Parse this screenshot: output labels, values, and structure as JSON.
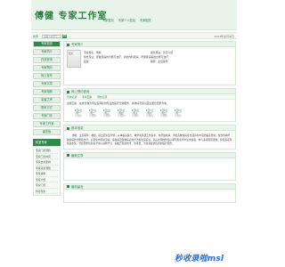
{
  "header": {
    "brand": "傅健  专家工作室",
    "nav": [
      "专家首页",
      "专家个人信息",
      "专家相关"
    ]
  },
  "search": {
    "label": "搜索",
    "placeholder": "请输入关键字",
    "button": "搜索",
    "right_text": "2024年某月某日"
  },
  "sidebar": {
    "buttons": [
      "专家首页",
      "专家简介",
      "在线咨询",
      "专家预约",
      "网上挂号",
      "专家文章",
      "专家相册",
      "患者之声",
      "联系方式",
      "专家门诊",
      "专家工作室",
      "留言板"
    ],
    "active_index": 0,
    "section_title": "科室专家",
    "list": [
      "专家门诊预约",
      "专家门诊时间",
      "专家出诊安排",
      "专家就诊须知",
      "专家资料",
      "专家介绍",
      "专家门诊",
      "科室专家"
    ]
  },
  "profile_panel": {
    "title": "专家简介",
    "photo_alt": "照片",
    "rows": [
      [
        "专家姓名：傅健",
        "擅长疾病：暂无介绍"
      ],
      [
        "擅长专业：肝脏疾病的诊断与治疗，消化内科疾病、肝胆疾病等的诊断与治疗",
        ""
      ],
      [
        "医院：",
        "职称：主任医师"
      ]
    ]
  },
  "consult_panel": {
    "title": "网上预约咨询",
    "tabs": [
      "咨询记录",
      "专家回复",
      "预约记录"
    ],
    "answer": "患者回复：在线咨询为专业医师提供专业的医疗咨询服务，具体情况请以医生面诊结果为准。",
    "days": [
      {
        "d": "5月2日",
        "w": "周一",
        "s": "可预约"
      },
      {
        "d": "5月3日",
        "w": "周二",
        "s": "可预约"
      },
      {
        "d": "5月4日",
        "w": "周三",
        "s": "可预约"
      },
      {
        "d": "5月5日",
        "w": "周四",
        "s": "可预约"
      },
      {
        "d": "5月6日",
        "w": "周五",
        "s": "可预约"
      },
      {
        "d": "5月7日",
        "w": "周六",
        "s": "可预约"
      },
      {
        "d": "5月8日",
        "w": "周日",
        "s": "可预约"
      },
      {
        "d": "5月9日",
        "w": "周一",
        "s": "可预约"
      }
    ]
  },
  "intro_panel": {
    "title": "基本信息",
    "text": "傅健，主任医师，教授，硕士研究生导师。从事临床医疗、教学和科研工作多年，在肝脏疾病、消化系统疾病等方面具有丰富的临床经验。擅长各种肝脏疾病的诊断和治疗，对消化内科常见病、多发病及疑难病症的诊治有较深造诣。先后在国内外核心期刊发表学术论文多篇，参与多项科研课题，获得多项科技进步奖。曾赴国外知名医学中心进修学习，积极开展新技术、新项目，为患者提供优质的医疗服务。"
  },
  "panel4": {
    "title": "最新文章"
  },
  "panel5": {
    "title": "最新留言"
  },
  "watermark": "秒收录啦msl",
  "colors": {
    "accent": "#2f8a48",
    "header_bg": "#e8f3ea",
    "watermark": "#2a6fd6"
  }
}
